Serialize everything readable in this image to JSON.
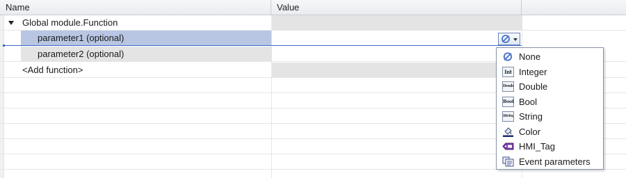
{
  "columns": {
    "name": "Name",
    "value": "Value"
  },
  "rows": [
    {
      "label": "Global module.Function"
    },
    {
      "label": "parameter1 (optional)"
    },
    {
      "label": "parameter2 (optional)"
    },
    {
      "label": "<Add function>"
    }
  ],
  "dropdown": {
    "button_icon": "none-icon",
    "items": [
      {
        "label": "None",
        "icon": "none-icon"
      },
      {
        "label": "Integer",
        "icon": "integer-type-icon",
        "icon_text": "Int"
      },
      {
        "label": "Double",
        "icon": "double-type-icon",
        "icon_text": "Double"
      },
      {
        "label": "Bool",
        "icon": "bool-type-icon",
        "icon_text": "Bool"
      },
      {
        "label": "String",
        "icon": "string-type-icon",
        "icon_text": "String"
      },
      {
        "label": "Color",
        "icon": "color-icon"
      },
      {
        "label": "HMI_Tag",
        "icon": "hmi-tag-icon"
      },
      {
        "label": "Event parameters",
        "icon": "event-parameters-icon"
      }
    ]
  },
  "colors": {
    "selection": "#b8c6e3",
    "accent": "#3d6cc8",
    "none_icon": "#4a72c8"
  }
}
